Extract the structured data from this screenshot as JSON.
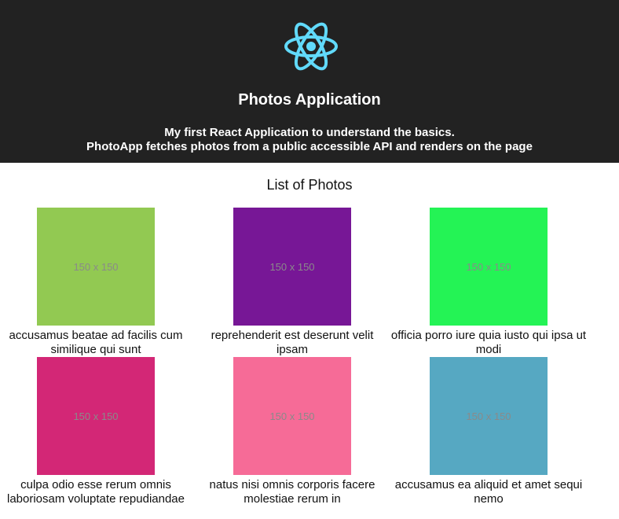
{
  "header": {
    "title": "Photos Application",
    "subtitle_line1": "My first React Application to understand the basics.",
    "subtitle_line2": "PhotoApp fetches photos from a public accessible API and renders on the page",
    "logo_icon": "react-atom-icon",
    "logo_color": "#61DAFB",
    "background": "#222222"
  },
  "main": {
    "list_title": "List of Photos",
    "photos": [
      {
        "placeholder": "150 x 150",
        "color": "#92C952",
        "title": "accusamus beatae ad facilis cum similique qui sunt"
      },
      {
        "placeholder": "150 x 150",
        "color": "#771796",
        "title": "reprehenderit est deserunt velit ipsam"
      },
      {
        "placeholder": "150 x 150",
        "color": "#24F355",
        "title": "officia porro iure quia iusto qui ipsa ut modi"
      },
      {
        "placeholder": "150 x 150",
        "color": "#D32776",
        "title": "culpa odio esse rerum omnis laboriosam voluptate repudiandae"
      },
      {
        "placeholder": "150 x 150",
        "color": "#F66B97",
        "title": "natus nisi omnis corporis facere molestiae rerum in"
      },
      {
        "placeholder": "150 x 150",
        "color": "#56A8C2",
        "title": "accusamus ea aliquid et amet sequi nemo"
      }
    ]
  }
}
